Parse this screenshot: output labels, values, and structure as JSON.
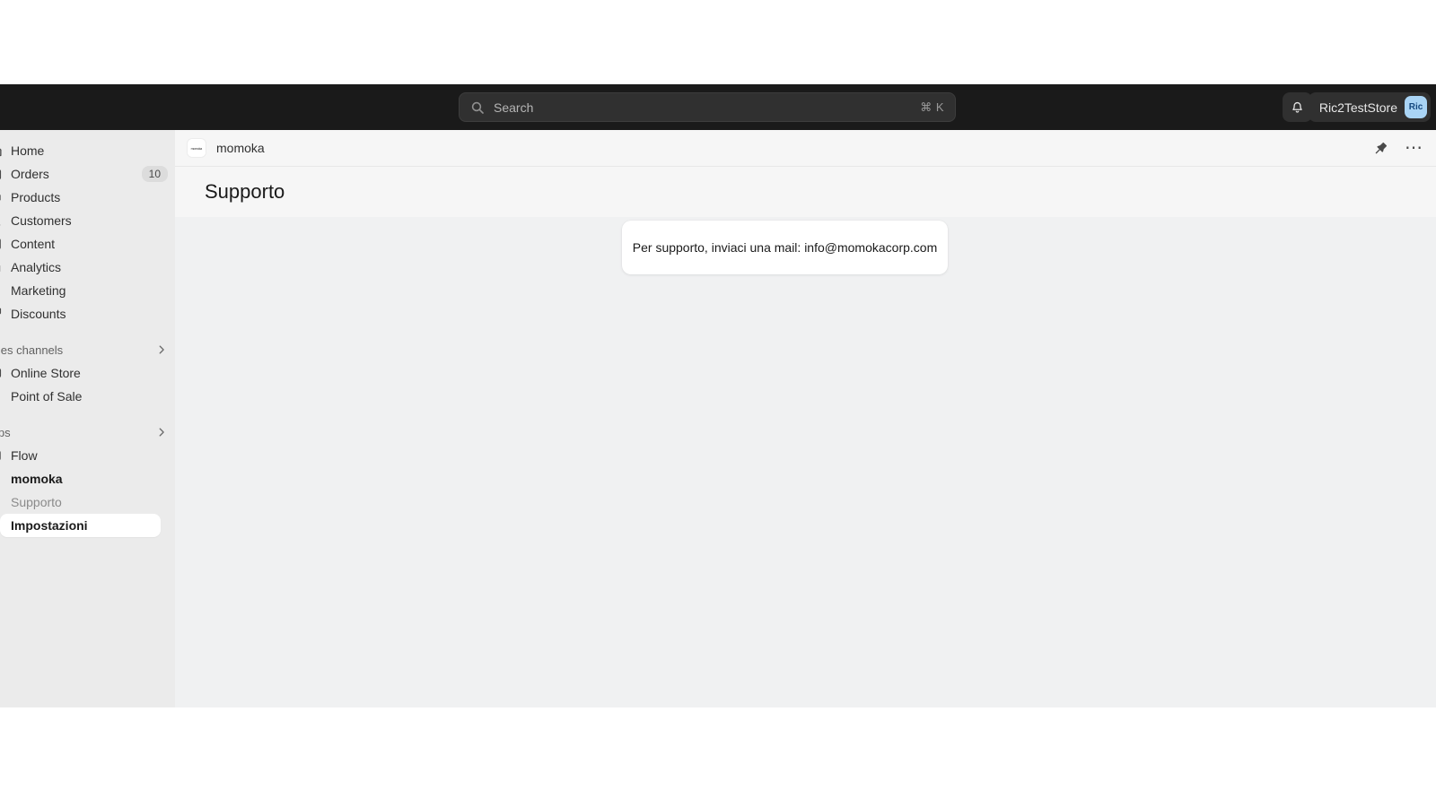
{
  "topbar": {
    "search": {
      "placeholder": "Search",
      "shortcut": "⌘ K",
      "icon": "search-icon"
    },
    "notifications_icon": "bell-icon",
    "store_name": "Ric2TestStore",
    "store_initials": "Ric",
    "avatar_color": "#a9d4f5",
    "background": "#1a1a1a"
  },
  "sidebar": {
    "background": "#ebebeb",
    "items": [
      {
        "label": "Home",
        "icon": "home-icon",
        "badge": null
      },
      {
        "label": "Orders",
        "icon": "orders-icon",
        "badge": "10"
      },
      {
        "label": "Products",
        "icon": "products-icon",
        "badge": null
      },
      {
        "label": "Customers",
        "icon": "customers-icon",
        "badge": null
      },
      {
        "label": "Content",
        "icon": "content-icon",
        "badge": null
      },
      {
        "label": "Analytics",
        "icon": "analytics-icon",
        "badge": null
      },
      {
        "label": "Marketing",
        "icon": "marketing-icon",
        "badge": null
      },
      {
        "label": "Discounts",
        "icon": "discounts-icon",
        "badge": null
      }
    ],
    "sales_channels": {
      "label": "Sales channels",
      "chevron": "chevron-right-icon",
      "items": [
        {
          "label": "Online Store",
          "icon": "online-store-icon"
        },
        {
          "label": "Point of Sale",
          "icon": "point-of-sale-icon"
        }
      ]
    },
    "apps": {
      "label": "Apps",
      "chevron": "chevron-right-icon",
      "items": [
        {
          "label": "Flow",
          "icon": "flow-icon",
          "state": "default"
        },
        {
          "label": "momoka",
          "icon": "momoka-icon",
          "state": "bold"
        },
        {
          "label": "Supporto",
          "icon": null,
          "state": "muted"
        },
        {
          "label": "Impostazioni",
          "icon": "arrow-right-icon",
          "state": "active"
        }
      ]
    }
  },
  "main": {
    "breadcrumb": {
      "app_name": "momoka",
      "app_logo_text": "momoka",
      "pin_icon": "pin-icon",
      "more_icon": "more-horizontal-icon"
    },
    "page_title": "Supporto",
    "card": {
      "text": "Per supporto, inviaci una mail: info@momokacorp.com"
    }
  }
}
